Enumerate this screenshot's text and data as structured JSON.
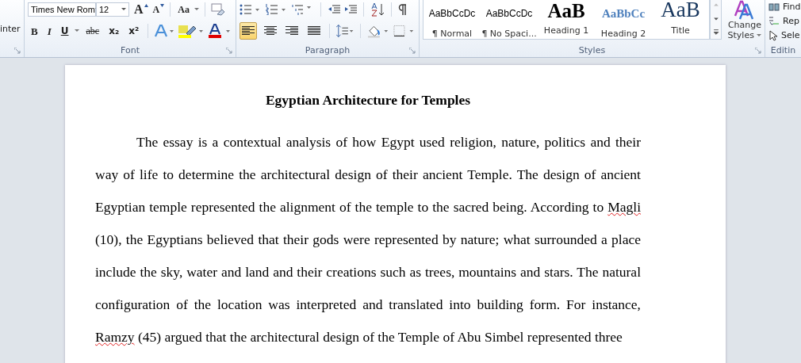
{
  "ribbon": {
    "clipboard": {
      "cut_label": "inter"
    },
    "font": {
      "font_name": "Times New Rom",
      "font_size": "12",
      "grow": "A",
      "shrink": "A",
      "change_case": "Aa",
      "format_buttons": [
        {
          "kind": "bold",
          "label": "B"
        },
        {
          "kind": "italic",
          "label": "I"
        },
        {
          "kind": "underline",
          "label": "U"
        },
        {
          "kind": "strike",
          "label": "abc"
        },
        {
          "kind": "sub",
          "label": "x₂"
        },
        {
          "kind": "sup",
          "label": "x²"
        }
      ],
      "label": "Font"
    },
    "paragraph": {
      "alignments": [
        {
          "kind": "left",
          "selected": true
        },
        {
          "kind": "center",
          "selected": false
        },
        {
          "kind": "right",
          "selected": false
        },
        {
          "kind": "justify",
          "selected": false
        }
      ],
      "label": "Paragraph"
    },
    "styles": {
      "items": [
        {
          "kind": "normal",
          "sample": "AaBbCcDc",
          "label": "¶ Normal"
        },
        {
          "kind": "nospacing",
          "sample": "AaBbCcDc",
          "label": "¶ No Spaci..."
        },
        {
          "kind": "heading1",
          "sample": "AaB",
          "label": "Heading 1"
        },
        {
          "kind": "heading2",
          "sample": "AaBbCc",
          "label": "Heading 2"
        },
        {
          "kind": "title",
          "sample": "AaB",
          "label": "Title"
        }
      ],
      "change_styles": "Change Styles",
      "label": "Styles"
    },
    "editing": {
      "items": [
        "Find",
        "Rep",
        "Sele"
      ],
      "label": "Editin"
    }
  },
  "document": {
    "title": "Egyptian Architecture for Temples",
    "paragraph": [
      {
        "text": "The essay is a contextual analysis of how Egypt used religion, nature, politics and their way of life to determine the architectural design of their ancient Temple. The design of ancient Egyptian temple represented the alignment of the temple to the sacred being. According to ",
        "misspelled": false
      },
      {
        "text": "Magli",
        "misspelled": true
      },
      {
        "text": " (10), the Egyptians believed that their gods were represented by nature; what surrounded a place include the sky, water and land and their creations such as trees, mountains and stars. The natural configuration of the location was interpreted and translated into building form. For instance, ",
        "misspelled": false
      },
      {
        "text": "Ramzy",
        "misspelled": true
      },
      {
        "text": " (45) argued that the architectural design of the Temple of Abu Simbel represented three",
        "misspelled": false
      }
    ]
  }
}
